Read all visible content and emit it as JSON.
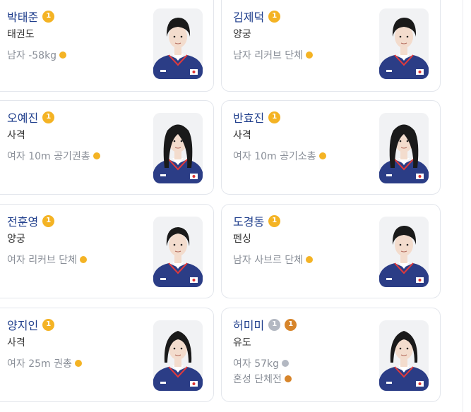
{
  "colors": {
    "gold": "#f4b324",
    "silver": "#b3b8c2",
    "bronze": "#d7852b",
    "name": "#1f3e8c",
    "muted": "#8a8f98",
    "jersey": "#2b3d86"
  },
  "athletes": [
    {
      "name": "박태준",
      "badges": [
        {
          "medal": "gold",
          "count": "1"
        }
      ],
      "sport": "태권도",
      "events": [
        {
          "label": "남자 -58kg",
          "medal": "gold"
        }
      ],
      "photo": {
        "gender": "male",
        "hair": "short",
        "icon": "athlete-portrait"
      }
    },
    {
      "name": "김제덕",
      "badges": [
        {
          "medal": "gold",
          "count": "1"
        }
      ],
      "sport": "양궁",
      "events": [
        {
          "label": "남자 리커브 단체",
          "medal": "gold"
        }
      ],
      "photo": {
        "gender": "male",
        "hair": "short",
        "icon": "athlete-portrait"
      }
    },
    {
      "name": "오예진",
      "badges": [
        {
          "medal": "gold",
          "count": "1"
        }
      ],
      "sport": "사격",
      "events": [
        {
          "label": "여자 10m 공기권총",
          "medal": "gold"
        }
      ],
      "photo": {
        "gender": "female",
        "hair": "long",
        "icon": "athlete-portrait"
      }
    },
    {
      "name": "반효진",
      "badges": [
        {
          "medal": "gold",
          "count": "1"
        }
      ],
      "sport": "사격",
      "events": [
        {
          "label": "여자 10m 공기소총",
          "medal": "gold"
        }
      ],
      "photo": {
        "gender": "female",
        "hair": "long",
        "icon": "athlete-portrait"
      }
    },
    {
      "name": "전훈영",
      "badges": [
        {
          "medal": "gold",
          "count": "1"
        }
      ],
      "sport": "양궁",
      "events": [
        {
          "label": "여자 리커브 단체",
          "medal": "gold"
        }
      ],
      "photo": {
        "gender": "female",
        "hair": "tied",
        "icon": "athlete-portrait"
      }
    },
    {
      "name": "도경동",
      "badges": [
        {
          "medal": "gold",
          "count": "1"
        }
      ],
      "sport": "펜싱",
      "events": [
        {
          "label": "남자 사브르 단체",
          "medal": "gold"
        }
      ],
      "photo": {
        "gender": "male",
        "hair": "short",
        "icon": "athlete-portrait"
      }
    },
    {
      "name": "양지인",
      "badges": [
        {
          "medal": "gold",
          "count": "1"
        }
      ],
      "sport": "사격",
      "events": [
        {
          "label": "여자 25m 권총",
          "medal": "gold"
        }
      ],
      "photo": {
        "gender": "female",
        "hair": "bob",
        "icon": "athlete-portrait"
      }
    },
    {
      "name": "허미미",
      "badges": [
        {
          "medal": "silver",
          "count": "1"
        },
        {
          "medal": "bronze",
          "count": "1"
        }
      ],
      "sport": "유도",
      "events": [
        {
          "label": "여자 57kg",
          "medal": "silver"
        },
        {
          "label": "혼성 단체전",
          "medal": "bronze"
        }
      ],
      "photo": {
        "gender": "female",
        "hair": "bob",
        "icon": "athlete-portrait"
      }
    }
  ]
}
